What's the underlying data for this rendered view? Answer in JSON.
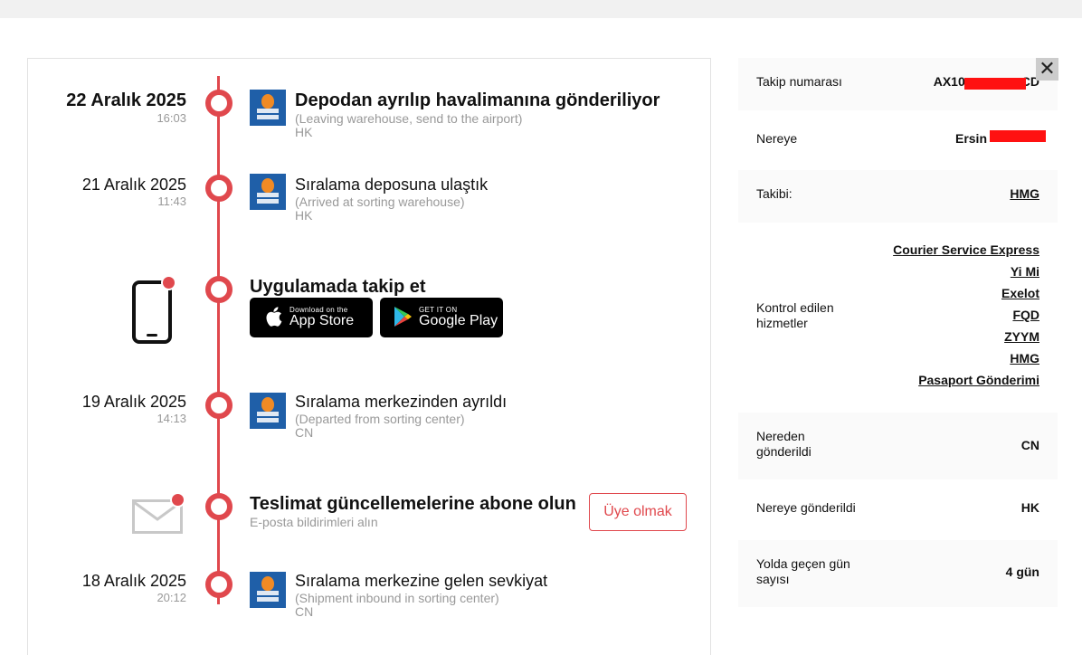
{
  "timeline": {
    "events": [
      {
        "date": "22 Aralık 2025",
        "time": "16:03",
        "title": "Depodan ayrılıp havalimanına gönderiliyor",
        "subtitle": "(Leaving warehouse, send to the airport)",
        "location": "HK"
      },
      {
        "date": "21 Aralık 2025",
        "time": "11:43",
        "title": "Sıralama deposuna ulaştık",
        "subtitle": "(Arrived at sorting warehouse)",
        "location": "HK"
      },
      {
        "date": "19 Aralık 2025",
        "time": "14:13",
        "title": "Sıralama merkezinden ayrıldı",
        "subtitle": "(Departed from sorting center)",
        "location": "CN"
      },
      {
        "date": "18 Aralık 2025",
        "time": "20:12",
        "title": "Sıralama merkezine gelen sevkiyat",
        "subtitle": "(Shipment inbound in sorting center)",
        "location": "CN"
      }
    ],
    "app_promo": {
      "title": "Uygulamada takip et",
      "app_store_small": "Download on the",
      "app_store_big": "App Store",
      "google_play_small": "GET IT ON",
      "google_play_big": "Google Play"
    },
    "subscribe": {
      "title": "Teslimat güncellemelerine abone olun",
      "subtitle": "E-posta bildirimleri alın",
      "button": "Üye olmak"
    }
  },
  "info": {
    "tracking_label": "Takip numarası",
    "tracking_value_prefix": "AX10",
    "tracking_value_suffix": "CD",
    "destination_label": "Nereye",
    "destination_value": "Ersin",
    "tracker_label": "Takibi:",
    "tracker_value": "HMG",
    "services_label": "Kontrol edilen hizmetler",
    "services": [
      "Courier Service Express",
      "Yi Mi",
      "Exelot",
      "FQD",
      "ZYYM",
      "HMG",
      "Pasaport Gönderimi"
    ],
    "from_label": "Nereden gönderildi",
    "from_value": "CN",
    "to_label": "Nereye gönderildi",
    "to_value": "HK",
    "days_label": "Yolda geçen gün sayısı",
    "days_value": "4 gün",
    "close_symbol": "✕"
  },
  "colors": {
    "accent": "#e0484d",
    "logo_blue": "#1f5fa8"
  }
}
